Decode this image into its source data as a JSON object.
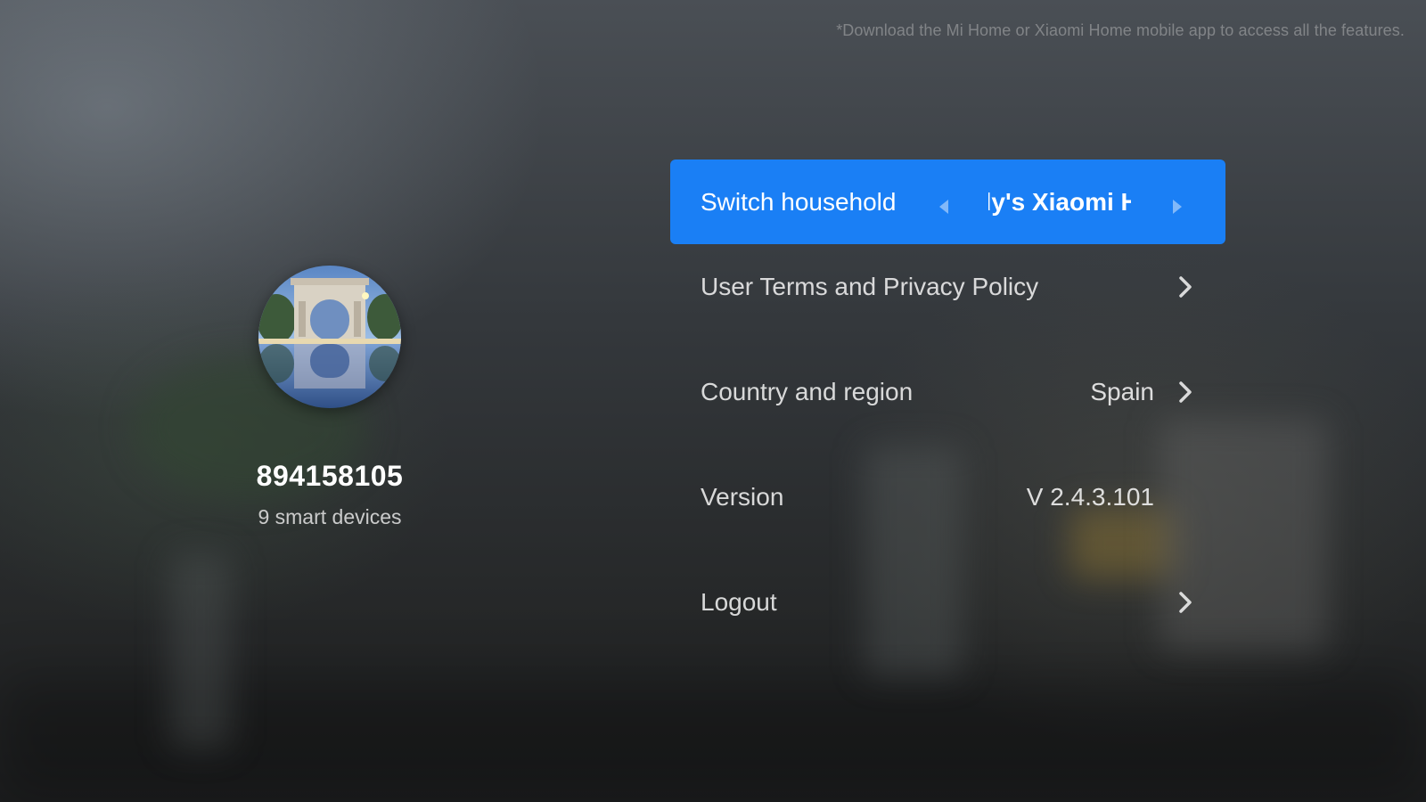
{
  "top_note": "*Download the Mi Home or Xiaomi Home mobile app to access all the features.",
  "profile": {
    "avatar_icon": "arch-monument-avatar",
    "username": "894158105",
    "device_count": "9 smart devices"
  },
  "menu": {
    "switch_household": {
      "label": "Switch household",
      "current_value": "Hedy's Xiaomi Home",
      "visible_value": "y's Xiaomi H"
    },
    "terms": {
      "label": "User Terms and Privacy Policy"
    },
    "region": {
      "label": "Country and region",
      "value": "Spain"
    },
    "version": {
      "label": "Version",
      "value": "V 2.4.3.101"
    },
    "logout": {
      "label": "Logout"
    }
  },
  "colors": {
    "accent": "#1a7ff5",
    "text": "#ffffff"
  }
}
